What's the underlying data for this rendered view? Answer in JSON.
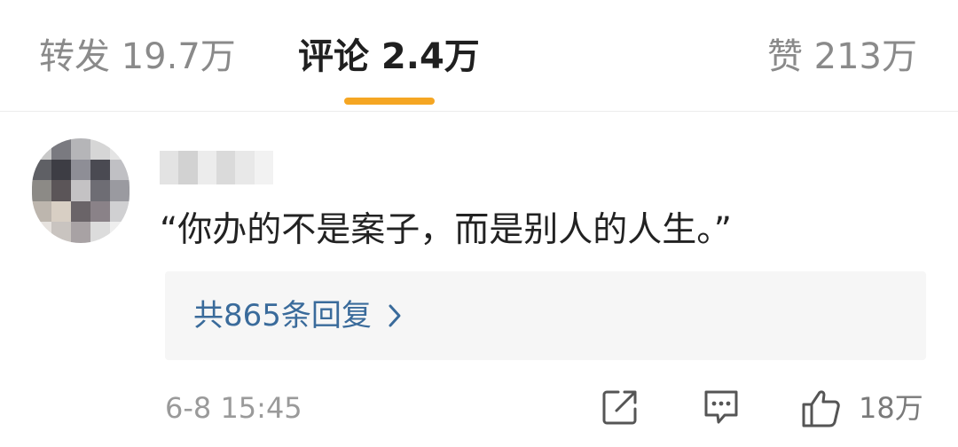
{
  "tabs": {
    "repost": "转发 19.7万",
    "comment": "评论 2.4万",
    "like": "赞 213万",
    "active": "comment",
    "accent_color": "#f5a623"
  },
  "comment": {
    "avatar_icon": "pixelated-avatar",
    "username_icon": "redacted-username",
    "text": "“你办的不是案子，而是别人的人生。”",
    "replies_label": "共865条回复",
    "replies_icon": "chevron-right-icon",
    "link_color": "#3a6b9b"
  },
  "footer": {
    "timestamp": "6-8 15:45",
    "share_icon": "share-icon",
    "comment_icon": "comment-icon",
    "like_icon": "thumbs-up-icon",
    "like_count": "18万"
  }
}
